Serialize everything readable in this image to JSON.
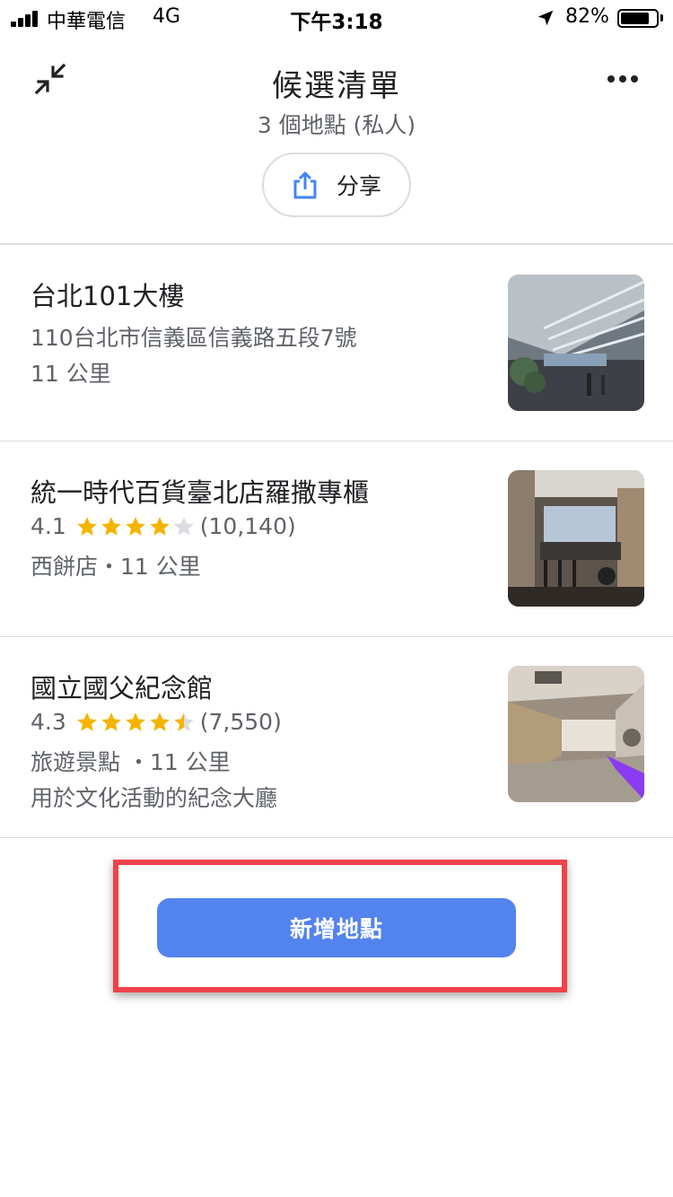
{
  "status_bar": {
    "carrier": "中華電信",
    "network": "4G",
    "time": "下午3:18",
    "battery_percent": "82%",
    "battery_level": 0.82,
    "signal_bars": 4
  },
  "header": {
    "title": "候選清單",
    "subtitle": "3 個地點 (私人)",
    "share_label": "分享",
    "collapse_icon": "collapse-arrows-icon",
    "more_icon": "more-horizontal-icon",
    "share_icon": "share-upload-icon"
  },
  "places": [
    {
      "name": "台北101大樓",
      "address": "110台北市信義區信義路五段7號",
      "distance": "11 公里"
    },
    {
      "name": "統一時代百貨臺北店羅撒專櫃",
      "rating": "4.1",
      "rating_value": 4.1,
      "review_count": "(10,140)",
      "category_distance": "西餅店・11 公里"
    },
    {
      "name": "國立國父紀念館",
      "rating": "4.3",
      "rating_value": 4.3,
      "review_count": "(7,550)",
      "category_distance": "旅遊景點 ・11 公里",
      "description": "用於文化活動的紀念大廳"
    }
  ],
  "add_button_label": "新增地點",
  "colors": {
    "accent": "#5383ec",
    "star_filled": "#f4b400",
    "star_empty": "#dadce0",
    "highlight_border": "#f0424a",
    "secondary_text": "#5f6368"
  }
}
